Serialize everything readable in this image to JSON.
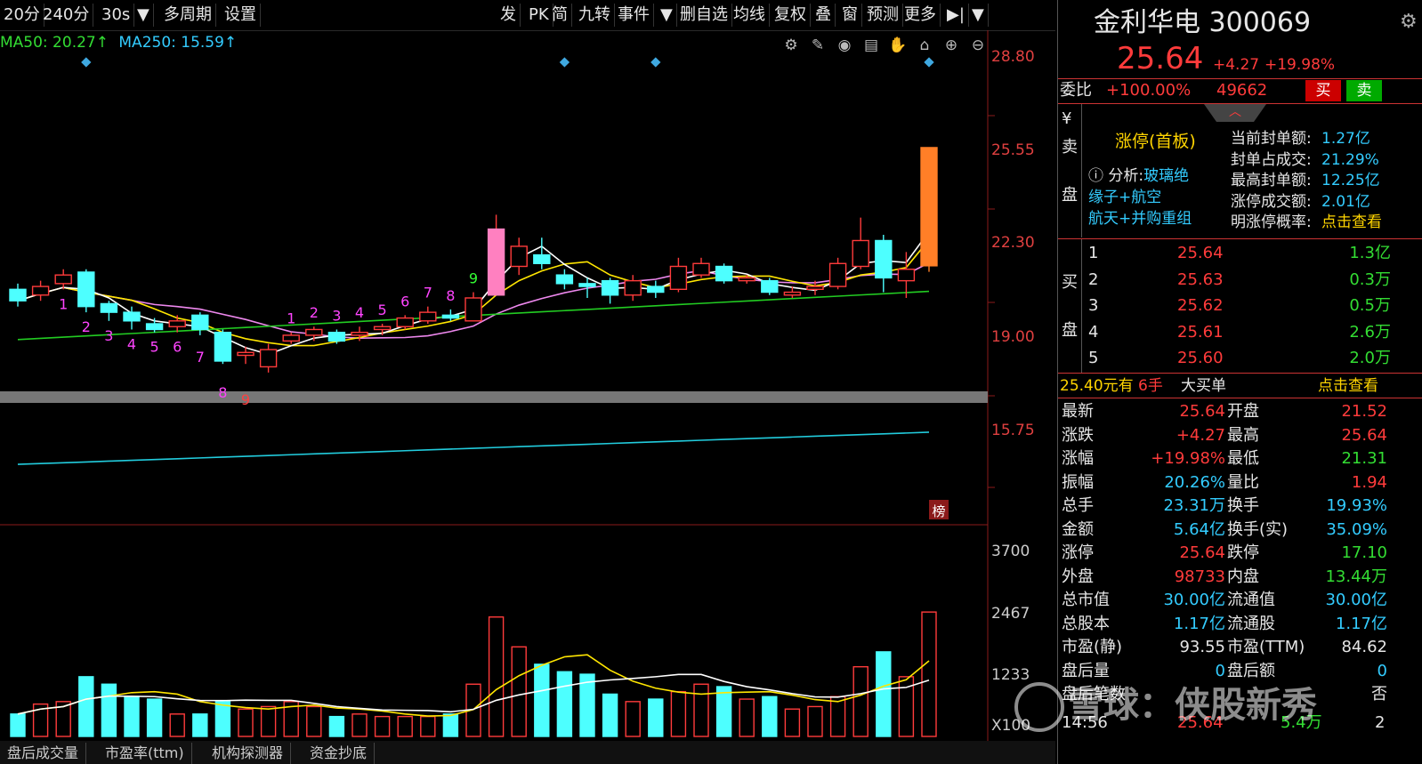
{
  "toolbar": {
    "items": [
      "20分",
      "240分",
      "30s",
      "▼",
      "多周期",
      "设置",
      "发",
      "PK",
      "简",
      "九转",
      "事件",
      "▼",
      "删自选",
      "均线",
      "复权",
      "叠",
      "窗",
      "预测",
      "更多",
      "▶|",
      "▼"
    ]
  },
  "legend": {
    "ma50_text": "MA50: 20.27↑",
    "ma250_text": "MA250: 15.59↑",
    "ma50_color": "#33dd33",
    "ma250_color": "#33ccff"
  },
  "chart_icons": [
    "gear-icon",
    "pen-icon",
    "eye-icon",
    "basket-icon",
    "hand-icon",
    "lock-icon",
    "zoom-in-icon",
    "zoom-out-icon"
  ],
  "price_axis": {
    "ticks": [
      "28.80",
      "25.55",
      "22.30",
      "19.00",
      "15.75"
    ]
  },
  "volume_axis": {
    "ticks": [
      "3700",
      "2467",
      "1233",
      "X100"
    ]
  },
  "chart_markers": {
    "bottom_seq": [
      "1",
      "2",
      "3",
      "4",
      "5",
      "6",
      "7",
      "8",
      "9"
    ],
    "top_seq": [
      "1",
      "2",
      "3",
      "4",
      "5",
      "6",
      "7",
      "8",
      "9"
    ],
    "bang_label": "榜"
  },
  "chart_data": {
    "type": "candlestick",
    "title": "",
    "ylim": [
      15.0,
      29.5
    ],
    "candles": [
      {
        "o": 20.7,
        "c": 20.3,
        "h": 20.9,
        "l": 20.1
      },
      {
        "o": 20.5,
        "c": 20.8,
        "h": 21.0,
        "l": 20.3
      },
      {
        "o": 20.9,
        "c": 21.2,
        "h": 21.4,
        "l": 20.7
      },
      {
        "o": 21.3,
        "c": 20.1,
        "h": 21.4,
        "l": 19.9
      },
      {
        "o": 20.2,
        "c": 19.9,
        "h": 20.3,
        "l": 19.6
      },
      {
        "o": 19.9,
        "c": 19.6,
        "h": 20.1,
        "l": 19.3
      },
      {
        "o": 19.5,
        "c": 19.3,
        "h": 19.7,
        "l": 19.2
      },
      {
        "o": 19.4,
        "c": 19.6,
        "h": 19.8,
        "l": 19.2
      },
      {
        "o": 19.8,
        "c": 19.3,
        "h": 19.9,
        "l": 19.1
      },
      {
        "o": 19.2,
        "c": 18.2,
        "h": 19.3,
        "l": 18.1
      },
      {
        "o": 18.4,
        "c": 18.5,
        "h": 18.7,
        "l": 18.1
      },
      {
        "o": 18.0,
        "c": 18.6,
        "h": 18.8,
        "l": 17.8
      },
      {
        "o": 18.9,
        "c": 19.1,
        "h": 19.2,
        "l": 18.8
      },
      {
        "o": 19.1,
        "c": 19.3,
        "h": 19.4,
        "l": 18.9
      },
      {
        "o": 19.2,
        "c": 18.9,
        "h": 19.3,
        "l": 18.8
      },
      {
        "o": 19.1,
        "c": 19.2,
        "h": 19.4,
        "l": 18.9
      },
      {
        "o": 19.3,
        "c": 19.4,
        "h": 19.5,
        "l": 19.1
      },
      {
        "o": 19.4,
        "c": 19.7,
        "h": 19.8,
        "l": 19.3
      },
      {
        "o": 19.6,
        "c": 19.9,
        "h": 20.1,
        "l": 19.5
      },
      {
        "o": 19.8,
        "c": 19.7,
        "h": 20.0,
        "l": 19.6
      },
      {
        "o": 19.6,
        "c": 20.4,
        "h": 20.6,
        "l": 19.6
      },
      {
        "o": 20.5,
        "c": 22.8,
        "h": 23.3,
        "l": 20.5
      },
      {
        "o": 21.5,
        "c": 22.2,
        "h": 22.5,
        "l": 21.2
      },
      {
        "o": 21.9,
        "c": 21.6,
        "h": 22.5,
        "l": 21.4
      },
      {
        "o": 21.2,
        "c": 20.9,
        "h": 21.4,
        "l": 20.7
      },
      {
        "o": 20.9,
        "c": 20.8,
        "h": 21.1,
        "l": 20.4
      },
      {
        "o": 21.0,
        "c": 20.5,
        "h": 21.1,
        "l": 20.2
      },
      {
        "o": 20.5,
        "c": 21.0,
        "h": 21.2,
        "l": 20.3
      },
      {
        "o": 20.8,
        "c": 20.6,
        "h": 21.0,
        "l": 20.4
      },
      {
        "o": 20.7,
        "c": 21.5,
        "h": 21.8,
        "l": 20.6
      },
      {
        "o": 21.2,
        "c": 21.6,
        "h": 21.8,
        "l": 21.1
      },
      {
        "o": 21.5,
        "c": 21.0,
        "h": 21.6,
        "l": 20.9
      },
      {
        "o": 21.0,
        "c": 21.1,
        "h": 21.2,
        "l": 20.9
      },
      {
        "o": 21.0,
        "c": 20.6,
        "h": 21.1,
        "l": 20.5
      },
      {
        "o": 20.5,
        "c": 20.6,
        "h": 20.8,
        "l": 20.4
      },
      {
        "o": 20.7,
        "c": 20.8,
        "h": 21.0,
        "l": 20.5
      },
      {
        "o": 20.8,
        "c": 21.6,
        "h": 21.8,
        "l": 20.7
      },
      {
        "o": 21.5,
        "c": 22.4,
        "h": 23.2,
        "l": 21.4
      },
      {
        "o": 22.4,
        "c": 21.1,
        "h": 22.6,
        "l": 20.6
      },
      {
        "o": 21.0,
        "c": 21.4,
        "h": 22.0,
        "l": 20.4
      },
      {
        "o": 21.52,
        "c": 25.64,
        "h": 25.64,
        "l": 21.31
      }
    ],
    "volume": [
      4.5,
      6.5,
      7.0,
      12.0,
      10.5,
      8.0,
      7.5,
      4.5,
      4.5,
      7.0,
      5.5,
      6.0,
      7.0,
      6.0,
      4.0,
      4.5,
      4.0,
      4.0,
      4.0,
      4.5,
      10.5,
      24.0,
      18.0,
      14.5,
      13.0,
      12.5,
      8.5,
      7.0,
      7.5,
      9.0,
      10.5,
      10.0,
      7.5,
      8.0,
      5.5,
      6.0,
      8.0,
      14.0,
      17.0,
      12.0,
      25.0
    ]
  },
  "quote": {
    "name_code": "金利华电 300069",
    "price": "25.64",
    "change": "+4.27",
    "change_pct": "+19.98%",
    "webi_label": "委比",
    "webi_value": "+100.00%",
    "webi_diff": "49662",
    "buy_btn": "买",
    "sell_btn": "卖"
  },
  "limit_box": {
    "side_chars": [
      "¥",
      "卖",
      "盘"
    ],
    "status": "涨停(首板)",
    "analysis_label": "分析:",
    "analysis_1": "玻璃绝",
    "analysis_2": "缘子+航空",
    "analysis_3": "航天+并购重组",
    "stats": [
      {
        "label": "当前封单额:",
        "value": "1.27亿"
      },
      {
        "label": "封单占成交:",
        "value": "21.29%"
      },
      {
        "label": "最高封单额:",
        "value": "12.25亿"
      },
      {
        "label": "涨停成交额:",
        "value": "2.01亿"
      },
      {
        "label": "明涨停概率:",
        "value": "点击查看"
      }
    ]
  },
  "order_book": {
    "side_chars": [
      "买",
      "盘"
    ],
    "rows": [
      {
        "lvl": "1",
        "price": "25.64",
        "vol": "1.3亿"
      },
      {
        "lvl": "2",
        "price": "25.63",
        "vol": "0.3万"
      },
      {
        "lvl": "3",
        "price": "25.62",
        "vol": "0.5万"
      },
      {
        "lvl": "4",
        "price": "25.61",
        "vol": "2.6万"
      },
      {
        "lvl": "5",
        "price": "25.60",
        "vol": "2.0万"
      }
    ],
    "big_order": {
      "price": "25.40元有",
      "hands": "6手",
      "text": "大买单",
      "link": "点击查看"
    }
  },
  "stats": [
    {
      "l1": "最新",
      "v1": "25.64",
      "c1": "red",
      "l2": "开盘",
      "v2": "21.52",
      "c2": "red"
    },
    {
      "l1": "涨跌",
      "v1": "+4.27",
      "c1": "red",
      "l2": "最高",
      "v2": "25.64",
      "c2": "red"
    },
    {
      "l1": "涨幅",
      "v1": "+19.98%",
      "c1": "red",
      "l2": "最低",
      "v2": "21.31",
      "c2": "green"
    },
    {
      "l1": "振幅",
      "v1": "20.26%",
      "c1": "cyan",
      "l2": "量比",
      "v2": "1.94",
      "c2": "red"
    },
    {
      "l1": "总手",
      "v1": "23.31万",
      "c1": "cyan",
      "l2": "换手",
      "v2": "19.93%",
      "c2": "cyan"
    },
    {
      "l1": "金额",
      "v1": "5.64亿",
      "c1": "cyan",
      "l2": "换手(实)",
      "v2": "35.09%",
      "c2": "cyan"
    },
    {
      "l1": "涨停",
      "v1": "25.64",
      "c1": "red",
      "l2": "跌停",
      "v2": "17.10",
      "c2": "green"
    },
    {
      "l1": "外盘",
      "v1": "98733",
      "c1": "red",
      "l2": "内盘",
      "v2": "13.44万",
      "c2": "green"
    },
    {
      "l1": "总市值",
      "v1": "30.00亿",
      "c1": "cyan",
      "l2": "流通值",
      "v2": "30.00亿",
      "c2": "cyan"
    },
    {
      "l1": "总股本",
      "v1": "1.17亿",
      "c1": "cyan",
      "l2": "流通股",
      "v2": "1.17亿",
      "c2": "cyan"
    },
    {
      "l1": "市盈(静)",
      "v1": "93.55",
      "c1": "white",
      "l2": "市盈(TTM)",
      "v2": "84.62",
      "c2": "white"
    },
    {
      "l1": "盘后量",
      "v1": "0",
      "c1": "cyan",
      "l2": "盘后额",
      "v2": "0",
      "c2": "cyan"
    },
    {
      "l1": "盘后笔数",
      "v1": "",
      "c1": "white",
      "l2": "",
      "v2": "否",
      "c2": "white"
    }
  ],
  "tick": {
    "time": "14:56",
    "price": "25.64",
    "vol": "5.4万",
    "n": "2"
  },
  "watermark": "雪球：侠股新秀",
  "bottom_tabs": [
    "盘后成交量",
    "市盈率(ttm)",
    "机构探测器",
    "资金抄底"
  ]
}
